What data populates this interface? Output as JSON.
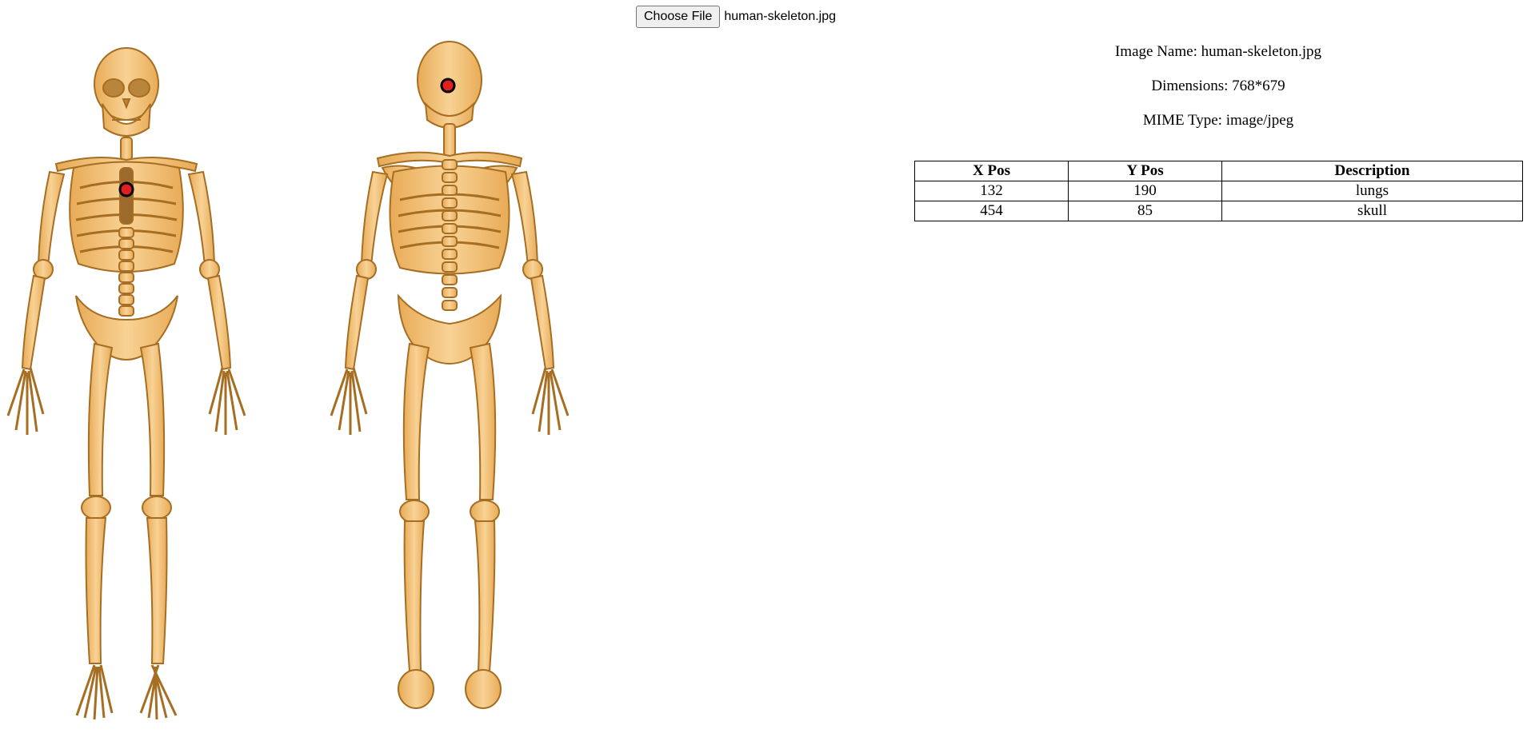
{
  "file_input": {
    "button_label": "Choose File",
    "file_name": "human-skeleton.jpg"
  },
  "image_info": {
    "name_text": "Image Name: human-skeleton.jpg",
    "dimensions_text": "Dimensions: 768*679",
    "mime_text": "MIME Type: image/jpeg"
  },
  "table": {
    "headers": [
      "X Pos",
      "Y Pos",
      "Description"
    ],
    "rows": [
      {
        "x": "132",
        "y": "190",
        "description": "lungs"
      },
      {
        "x": "454",
        "y": "85",
        "description": "skull"
      }
    ]
  },
  "image": {
    "subject": "human-skeleton-front-and-back-illustration",
    "bone_color": "#f3c27a",
    "bone_outline": "#b07a2a",
    "marker_color": "#e02020"
  }
}
